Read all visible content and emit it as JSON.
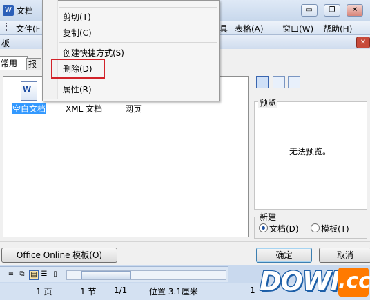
{
  "window": {
    "app_icon": "W",
    "title": "文档",
    "buttons": {
      "minimize": "▭",
      "restore": "❐",
      "close": "✕"
    }
  },
  "menubar": {
    "items": [
      "文件(F",
      "具",
      "表格(A)",
      "窗口(W)",
      "帮助(H)"
    ]
  },
  "dialog": {
    "title": "板",
    "close_label": "✕",
    "tabs": [
      "常用",
      "报"
    ],
    "templates": [
      "空白文档",
      "XML 文档",
      "网页"
    ],
    "doc_icon_letter": "W",
    "preview_legend": "预览",
    "preview_text": "无法预览。",
    "new_legend": "新建",
    "new_options": [
      {
        "label": "文档(D)",
        "checked": true
      },
      {
        "label": "模板(T)",
        "checked": false
      }
    ],
    "online_button": "Office Online 模板(O)",
    "ok_button": "确定",
    "cancel_button": "取消"
  },
  "context_menu": {
    "items": [
      "剪切(T)",
      "复制(C)",
      "创建快捷方式(S)",
      "删除(D)",
      "属性(R)"
    ],
    "highlight_color": "#d2232a"
  },
  "statusbar": {
    "page": "1 页",
    "section": "1 节",
    "page_of": "1/1",
    "position": "位置 3.1厘米",
    "right_value": "1"
  },
  "watermark": {
    "text": "DOWN",
    "suffix": ".cc",
    "accent": "#ff7a00"
  }
}
